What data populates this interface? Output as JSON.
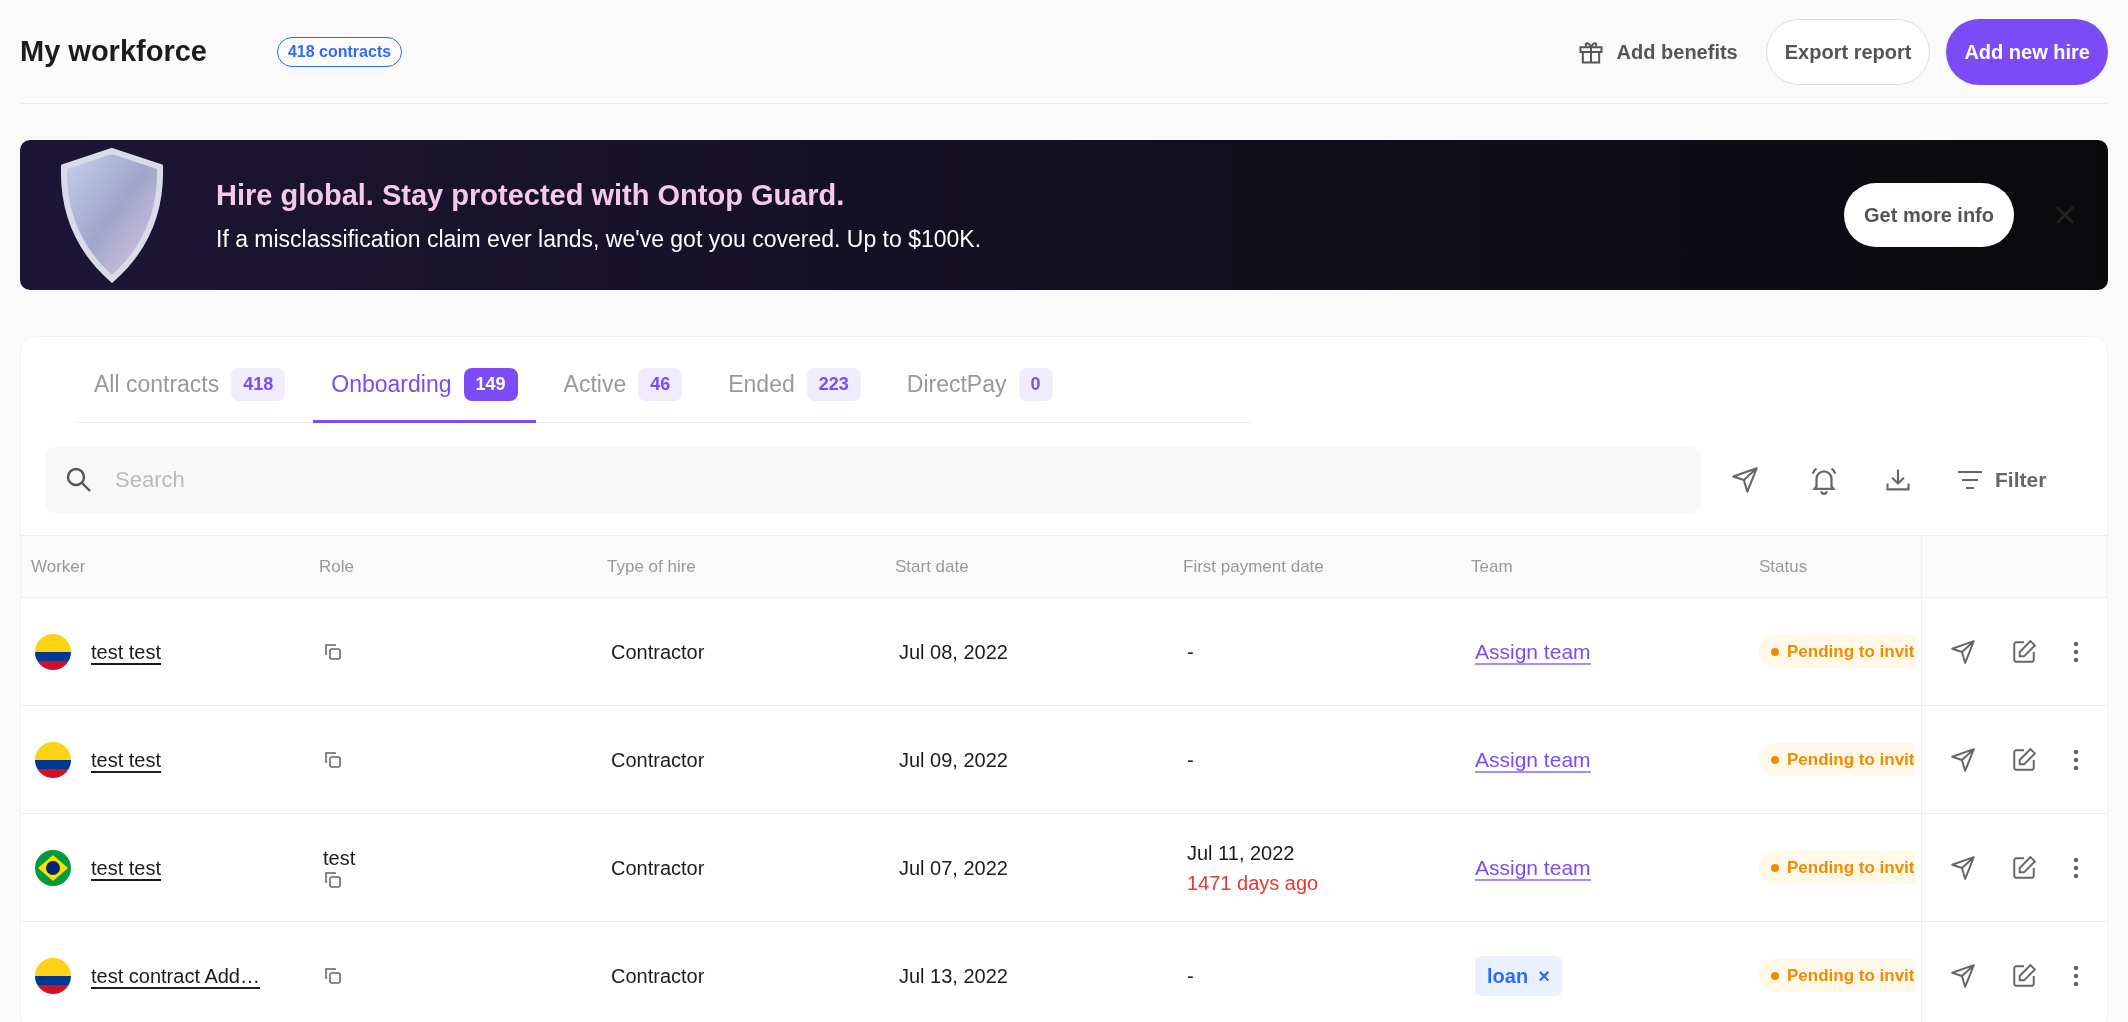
{
  "header": {
    "title": "My workforce",
    "count_badge": "418 contracts",
    "actions": [
      {
        "kind": "ghost",
        "label": "Add benefits"
      },
      {
        "kind": "outline",
        "label": "Export report"
      },
      {
        "kind": "primary",
        "label": "Add new hire"
      }
    ]
  },
  "banner": {
    "title": "Hire global. Stay protected with Ontop Guard.",
    "text": "If a misclassification claim ever lands, we've got you covered. Up to $100K.",
    "button": "Get more info"
  },
  "tabs": [
    {
      "label": "All contracts",
      "count": "418",
      "selected": false
    },
    {
      "label": "Onboarding",
      "count": "149",
      "selected": true
    },
    {
      "label": "Active",
      "count": "46",
      "selected": false
    },
    {
      "label": "Ended",
      "count": "223",
      "selected": false
    },
    {
      "label": "DirectPay",
      "count": "0",
      "selected": false
    }
  ],
  "search": {
    "placeholder": "Search"
  },
  "toolbar": {
    "filter_label": "Filter"
  },
  "table": {
    "columns": [
      "Worker",
      "Role",
      "Type of hire",
      "Start date",
      "First payment date",
      "Team",
      "Status"
    ],
    "rows": [
      {
        "kind": "colombia",
        "worker": "test test",
        "type": "Contractor",
        "start": "Jul 08, 2022",
        "payment": "-",
        "team": {
          "kind": "link",
          "text": "Assign team"
        },
        "status": "Pending to invit"
      },
      {
        "kind": "colombia",
        "worker": "test test",
        "type": "Contractor",
        "start": "Jul 09, 2022",
        "payment": "-",
        "team": {
          "kind": "link",
          "text": "Assign team"
        },
        "status": "Pending to invit"
      },
      {
        "kind": "brazil",
        "worker": "test test",
        "role": "test",
        "type": "Contractor",
        "start": "Jul 07, 2022",
        "payment": "Jul 11, 2022",
        "payment_note": "1471 days ago",
        "team": {
          "kind": "link",
          "text": "Assign team"
        },
        "status": "Pending to invit"
      },
      {
        "kind": "colombia",
        "worker": "test contract Add…",
        "type": "Contractor",
        "start": "Jul 13, 2022",
        "payment": "-",
        "team": {
          "kind": "tag",
          "text": "loan",
          "remove": "×"
        },
        "status": "Pending to invit"
      }
    ]
  }
}
